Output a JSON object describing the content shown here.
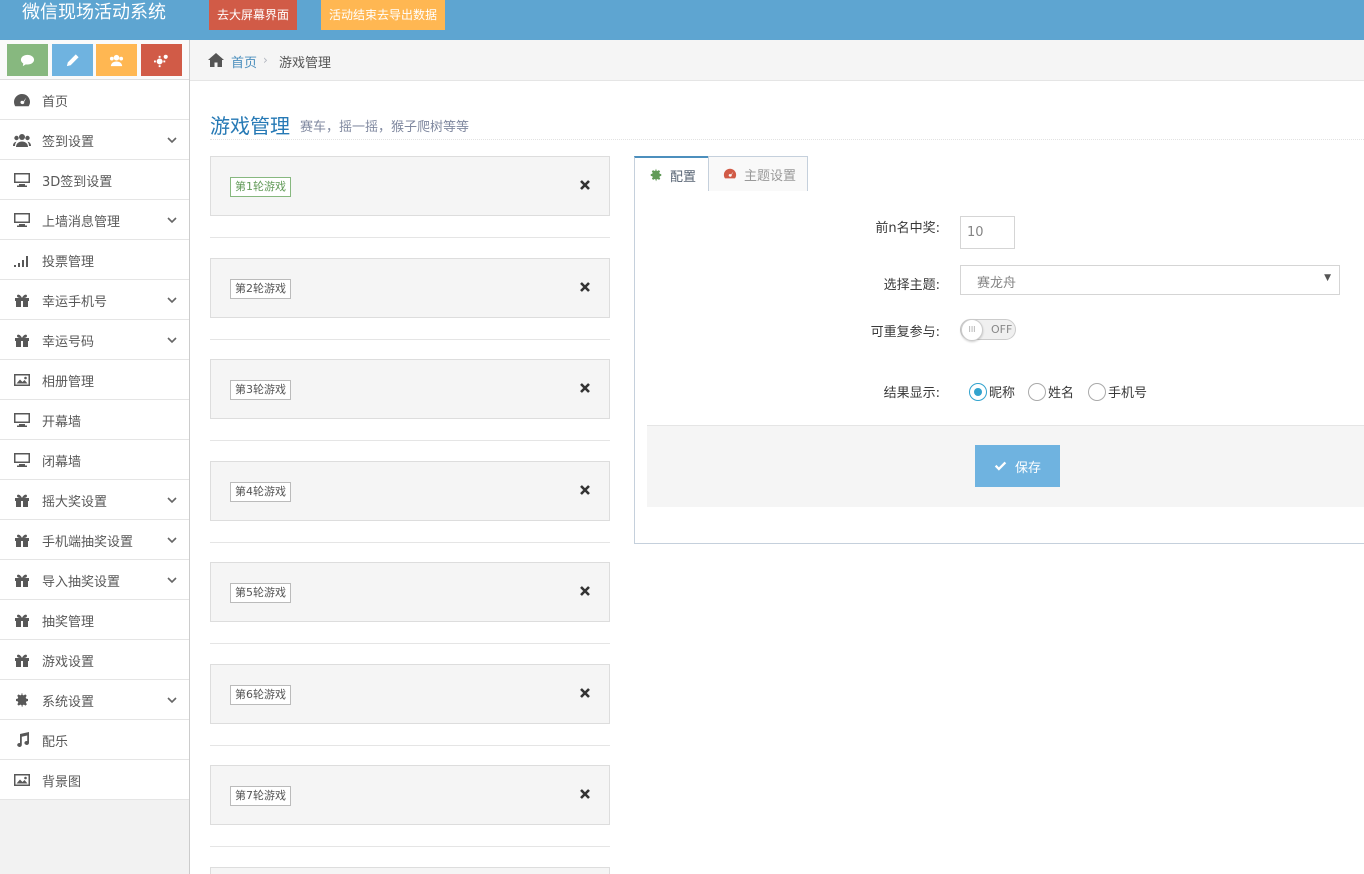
{
  "navbar": {
    "brand": "微信现场活动系统",
    "big_screen_button": "去大屏幕界面",
    "export_button": "活动结束去导出数据"
  },
  "sidebar": {
    "items": [
      {
        "label": "首页",
        "icon": "dashboard-icon",
        "submenu": false
      },
      {
        "label": "签到设置",
        "icon": "users-icon",
        "submenu": true
      },
      {
        "label": "3D签到设置",
        "icon": "desktop-icon",
        "submenu": false
      },
      {
        "label": "上墙消息管理",
        "icon": "desktop-icon",
        "submenu": true
      },
      {
        "label": "投票管理",
        "icon": "signal-icon",
        "submenu": false
      },
      {
        "label": "幸运手机号",
        "icon": "gift-icon",
        "submenu": true
      },
      {
        "label": "幸运号码",
        "icon": "gift-icon",
        "submenu": true
      },
      {
        "label": "相册管理",
        "icon": "picture-icon",
        "submenu": false
      },
      {
        "label": "开幕墙",
        "icon": "desktop-icon",
        "submenu": false
      },
      {
        "label": "闭幕墙",
        "icon": "desktop-icon",
        "submenu": false
      },
      {
        "label": "摇大奖设置",
        "icon": "gift-icon",
        "submenu": true
      },
      {
        "label": "手机端抽奖设置",
        "icon": "gift-icon",
        "submenu": true
      },
      {
        "label": "导入抽奖设置",
        "icon": "gift-icon",
        "submenu": true
      },
      {
        "label": "抽奖管理",
        "icon": "gift-icon",
        "submenu": false
      },
      {
        "label": "游戏设置",
        "icon": "gift-icon",
        "submenu": false
      },
      {
        "label": "系统设置",
        "icon": "gear-icon",
        "submenu": true
      },
      {
        "label": "配乐",
        "icon": "music-icon",
        "submenu": false
      },
      {
        "label": "背景图",
        "icon": "picture-icon",
        "submenu": false
      }
    ]
  },
  "breadcrumb": {
    "home": "首页",
    "separator": "›",
    "current": "游戏管理"
  },
  "page": {
    "title": "游戏管理",
    "subtitle": "赛车，摇一摇，猴子爬树等等"
  },
  "games": [
    {
      "label": "第1轮游戏",
      "active": true
    },
    {
      "label": "第2轮游戏",
      "active": false
    },
    {
      "label": "第3轮游戏",
      "active": false
    },
    {
      "label": "第4轮游戏",
      "active": false
    },
    {
      "label": "第5轮游戏",
      "active": false
    },
    {
      "label": "第6轮游戏",
      "active": false
    },
    {
      "label": "第7轮游戏",
      "active": false
    }
  ],
  "tabs": {
    "config": "配置",
    "theme": "主题设置"
  },
  "form": {
    "top_n_label": "前n名中奖:",
    "top_n_value": "10",
    "theme_label": "选择主题:",
    "theme_value": "赛龙舟",
    "repeat_label": "可重复参与:",
    "repeat_knob": "III",
    "repeat_state": "OFF",
    "result_label": "结果显示:",
    "result_options": [
      "昵称",
      "姓名",
      "手机号"
    ],
    "result_selected": "昵称",
    "save_button": "保存"
  },
  "colors": {
    "navbar": "#5ea5d1",
    "red": "#d15b47",
    "orange": "#ffb752",
    "green": "#87b87f",
    "blue": "#6fb3e0",
    "link": "#2679b5"
  }
}
